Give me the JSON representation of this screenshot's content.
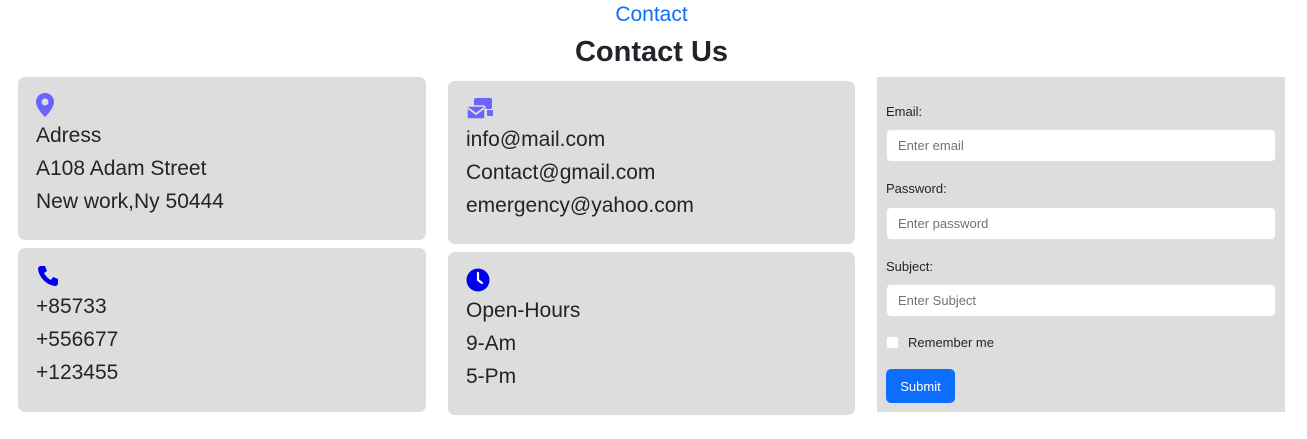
{
  "nav": {
    "link": "Contact"
  },
  "page": {
    "title": "Contact Us"
  },
  "cards": {
    "address": {
      "icon": "map-pin-icon",
      "lines": [
        "Adress",
        "A108 Adam Street",
        "New work,Ny 50444"
      ]
    },
    "email": {
      "icon": "mail-stack-icon",
      "lines": [
        "info@mail.com",
        "Contact@gmail.com",
        "emergency@yahoo.com"
      ]
    },
    "phone": {
      "icon": "phone-icon",
      "lines": [
        "+85733",
        "+556677",
        "+123455"
      ]
    },
    "hours": {
      "icon": "clock-icon",
      "lines": [
        "Open-Hours",
        "9-Am",
        "5-Pm"
      ]
    }
  },
  "form": {
    "email_label": "Email:",
    "email_placeholder": "Enter email",
    "password_label": "Password:",
    "password_placeholder": "Enter password",
    "subject_label": "Subject:",
    "subject_placeholder": "Enter Subject",
    "remember_label": "Remember me",
    "submit_label": "Submit"
  },
  "colors": {
    "accent": "#0d6efd",
    "card_bg": "#dddddd",
    "icon_purple": "#6c63ff",
    "icon_blue": "#0000ee"
  }
}
